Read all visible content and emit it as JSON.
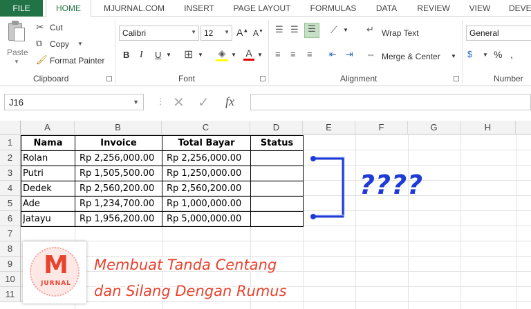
{
  "tabs": [
    "FILE",
    "HOME",
    "MJURNAL.COM",
    "INSERT",
    "PAGE LAYOUT",
    "FORMULAS",
    "DATA",
    "REVIEW",
    "VIEW",
    "DEVE"
  ],
  "clipboard": {
    "paste": "Paste",
    "cut": "Cut",
    "copy": "Copy",
    "format_painter": "Format Painter",
    "label": "Clipboard"
  },
  "font": {
    "name": "Calibri",
    "size": "12",
    "bold": "B",
    "italic": "I",
    "underline": "U",
    "label": "Font"
  },
  "alignment": {
    "wrap_text": "Wrap Text",
    "merge_center": "Merge & Center",
    "label": "Alignment"
  },
  "number": {
    "format": "General",
    "label": "Number",
    "percent": "%"
  },
  "formula_bar": {
    "name_box": "J16",
    "fx": "fx",
    "value": ""
  },
  "columns": [
    "A",
    "B",
    "C",
    "D",
    "E",
    "F",
    "G",
    "H"
  ],
  "rows": [
    "1",
    "2",
    "3",
    "4",
    "5",
    "6",
    "7",
    "8",
    "9",
    "10",
    "11"
  ],
  "table": {
    "headers": [
      "Nama",
      "Invoice",
      "Total Bayar",
      "Status"
    ],
    "rows": [
      [
        "Rolan",
        "Rp 2,256,000.00",
        "Rp 2,256,000.00",
        ""
      ],
      [
        "Putri",
        "Rp 1,505,500.00",
        "Rp 1,250,000.00",
        ""
      ],
      [
        "Dedek",
        "Rp 2,560,200.00",
        "Rp 2,560,200.00",
        ""
      ],
      [
        "Ade",
        "Rp 1,234,700.00",
        "Rp 1,000,000.00",
        ""
      ],
      [
        "Jatayu",
        "Rp 1,956,200.00",
        "Rp 5,000,000.00",
        ""
      ]
    ]
  },
  "annotation": {
    "question": "????",
    "color": "#1f3bd6"
  },
  "logo": {
    "letter": "M",
    "word": "JURNAL"
  },
  "overlay_title": {
    "line1": "Membuat Tanda Centang",
    "line2": "dan Silang Dengan Rumus",
    "color": "#e8432f"
  },
  "colors": {
    "excel_green": "#217346"
  }
}
